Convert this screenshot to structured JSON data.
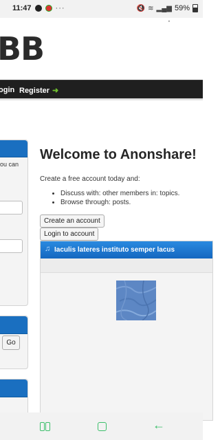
{
  "status_bar": {
    "time": "11:47",
    "more": "···",
    "battery": "59%"
  },
  "site": {
    "logo_text": "BB",
    "nav": {
      "login": "ogin",
      "register": "Register",
      "register_arrow": "➜"
    }
  },
  "sidebar": {
    "fragment_text": "ou can",
    "go_label": "Go"
  },
  "main": {
    "welcome_title": "Welcome to Anonshare!",
    "intro_text": "Create a free account today and:",
    "bullets": [
      "Discuss with: other members in: topics.",
      "Browse through: posts."
    ],
    "create_account_label": "Create an account",
    "login_account_label": "Login to account",
    "feature_title": "Iaculis lateres instituto semper lacus"
  },
  "android_nav": {
    "back_glyph": "←"
  },
  "colors": {
    "nav_bg": "#1f1f1f",
    "panel_header": "#1a6fc0",
    "feature_header": "#1a76d2",
    "android_nav_accent": "#3bbf6a"
  }
}
